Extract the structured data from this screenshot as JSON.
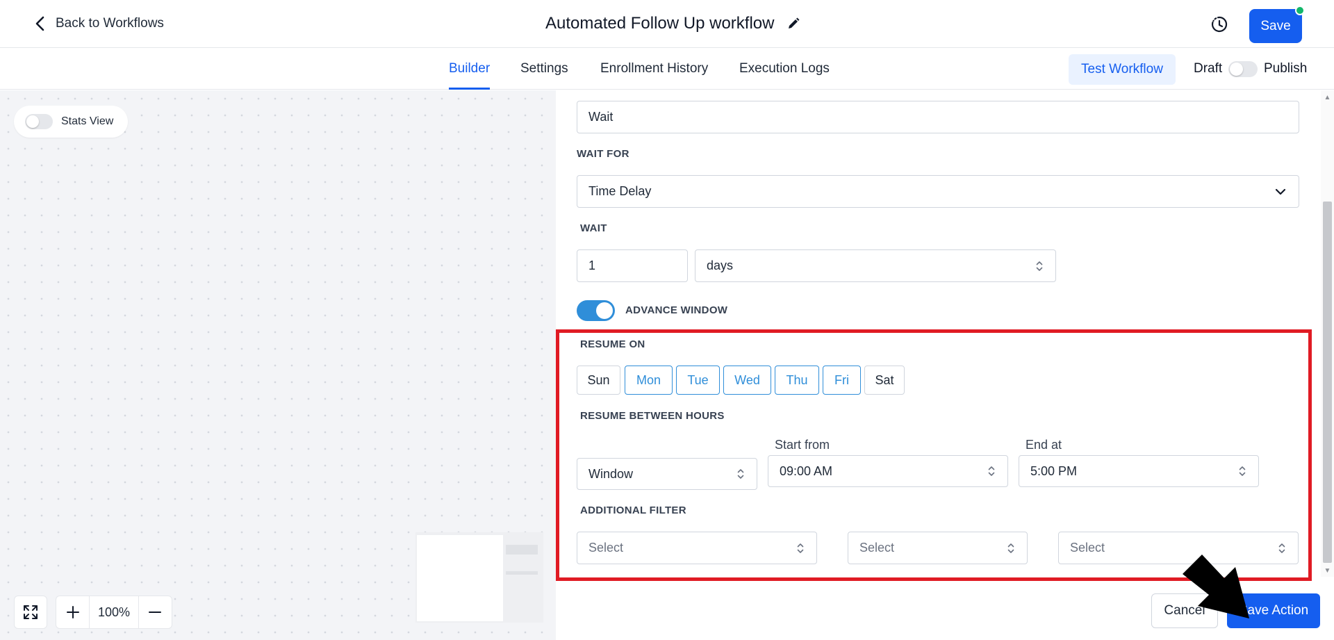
{
  "header": {
    "back_label": "Back to Workflows",
    "workflow_title": "Automated Follow Up workflow",
    "save_label": "Save"
  },
  "tabs": {
    "builder": "Builder",
    "settings": "Settings",
    "enrollment_history": "Enrollment History",
    "execution_logs": "Execution Logs"
  },
  "toolbar": {
    "test_workflow": "Test Workflow",
    "draft": "Draft",
    "publish": "Publish"
  },
  "canvas": {
    "stats_view": "Stats View",
    "zoom_level": "100%"
  },
  "action_panel": {
    "action_name": "Wait",
    "wait_for_label": "WAIT FOR",
    "wait_for_value": "Time Delay",
    "wait_label": "WAIT",
    "wait_amount": "1",
    "wait_unit": "days",
    "advance_window_label": "ADVANCE WINDOW",
    "resume_on_label": "RESUME ON",
    "days": [
      "Sun",
      "Mon",
      "Tue",
      "Wed",
      "Thu",
      "Fri",
      "Sat"
    ],
    "selected_days": [
      "Mon",
      "Tue",
      "Wed",
      "Thu",
      "Fri"
    ],
    "resume_between_hours_label": "RESUME BETWEEN HOURS",
    "hours_mode": "Window",
    "start_from_label": "Start from",
    "start_from_value": "09:00 AM",
    "end_at_label": "End at",
    "end_at_value": "5:00 PM",
    "additional_filter_label": "ADDITIONAL FILTER",
    "filter_placeholder": "Select",
    "cancel_label": "Cancel",
    "save_action_label": "Save Action"
  },
  "colors": {
    "primary": "#155eef",
    "toggle_on": "#2f8ed9",
    "highlight": "#e01b24",
    "status_dot": "#12b76a"
  }
}
